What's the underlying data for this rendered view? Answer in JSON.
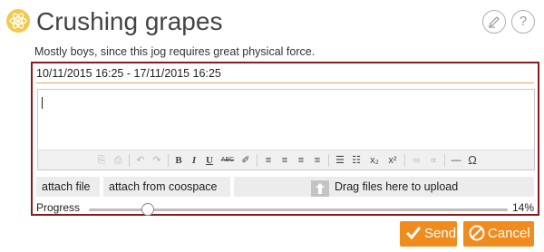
{
  "header": {
    "title": "Crushing grapes",
    "icon": "atom-icon",
    "edit_icon": "pen-icon",
    "help_label": "?"
  },
  "description": "Mostly boys, since this jog requires great physical force.",
  "daterange": "10/11/2015 16:25 - 17/11/2015 16:25",
  "editor": {
    "toolbar": [
      {
        "name": "paste-icon",
        "glyph": "⎘"
      },
      {
        "name": "paste-text-icon",
        "glyph": "⎙"
      },
      {
        "name": "undo-icon",
        "glyph": "↶"
      },
      {
        "name": "redo-icon",
        "glyph": "↷"
      },
      {
        "name": "bold-icon",
        "glyph": "B"
      },
      {
        "name": "italic-icon",
        "glyph": "I"
      },
      {
        "name": "underline-icon",
        "glyph": "U"
      },
      {
        "name": "strikethrough-icon",
        "glyph": "ABC"
      },
      {
        "name": "eraser-icon",
        "glyph": "✐"
      },
      {
        "name": "align-left-icon",
        "glyph": "≡"
      },
      {
        "name": "align-center-icon",
        "glyph": "≡"
      },
      {
        "name": "align-right-icon",
        "glyph": "≡"
      },
      {
        "name": "align-justify-icon",
        "glyph": "≡"
      },
      {
        "name": "bulleted-list-icon",
        "glyph": "☰"
      },
      {
        "name": "numbered-list-icon",
        "glyph": "☷"
      },
      {
        "name": "subscript-icon",
        "glyph": "x₂"
      },
      {
        "name": "superscript-icon",
        "glyph": "x²"
      },
      {
        "name": "link-icon",
        "glyph": "∞"
      },
      {
        "name": "unlink-icon",
        "glyph": "∝"
      },
      {
        "name": "horizontal-rule-icon",
        "glyph": "—"
      },
      {
        "name": "special-char-icon",
        "glyph": "Ω"
      }
    ]
  },
  "attach_file_label": "attach file",
  "attach_coospace_label": "attach from coospace",
  "dropzone_text": "Drag files here to upload",
  "progress": {
    "label": "Progress",
    "value_text": "14%",
    "fraction": 0.14
  },
  "actions": {
    "send_label": "Send",
    "cancel_label": "Cancel",
    "send_icon": "checkmark-icon",
    "cancel_icon": "no-entry-icon"
  },
  "colors": {
    "accent": "#f08c1e",
    "panel_border": "#8b1a1a",
    "date_underline": "#e8a35a",
    "app_icon": "#f2c94c"
  }
}
